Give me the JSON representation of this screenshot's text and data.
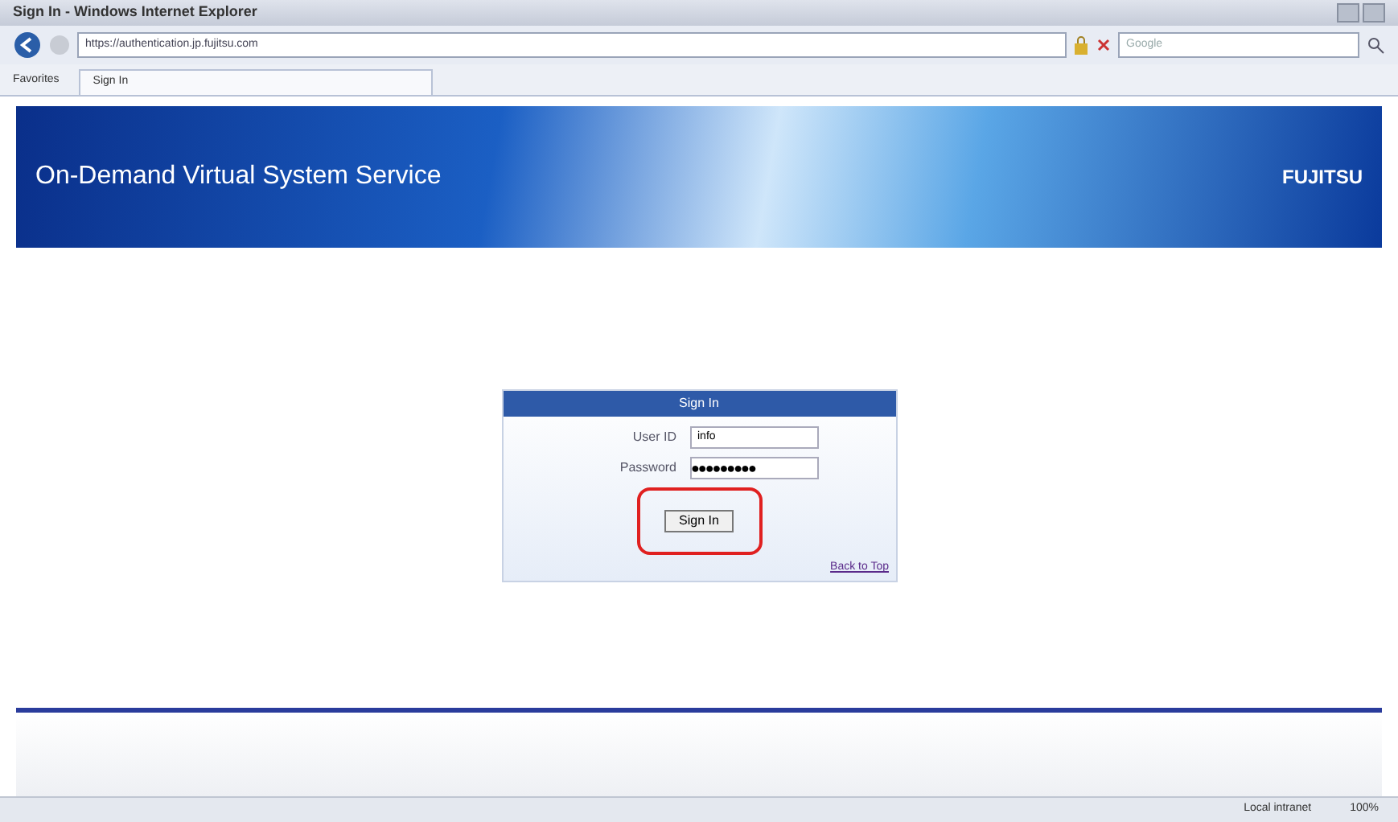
{
  "window": {
    "title": "Sign In - Windows Internet Explorer"
  },
  "address_bar": {
    "url": "https://authentication.jp.fujitsu.com",
    "search_placeholder": "Google"
  },
  "favorites_bar": {
    "favorites": "Favorites",
    "tab": "Sign In"
  },
  "banner": {
    "title": "On-Demand Virtual System Service",
    "logo": "FUJITSU"
  },
  "login": {
    "header": "Sign In",
    "user_label": "User ID",
    "user_value": "info",
    "password_label": "Password",
    "password_value": "●●●●●●●●●",
    "button": "Sign In",
    "highlighted": true,
    "back_link": "Back to Top"
  },
  "status_bar": {
    "zone": "Local intranet",
    "zoom": "100%"
  }
}
